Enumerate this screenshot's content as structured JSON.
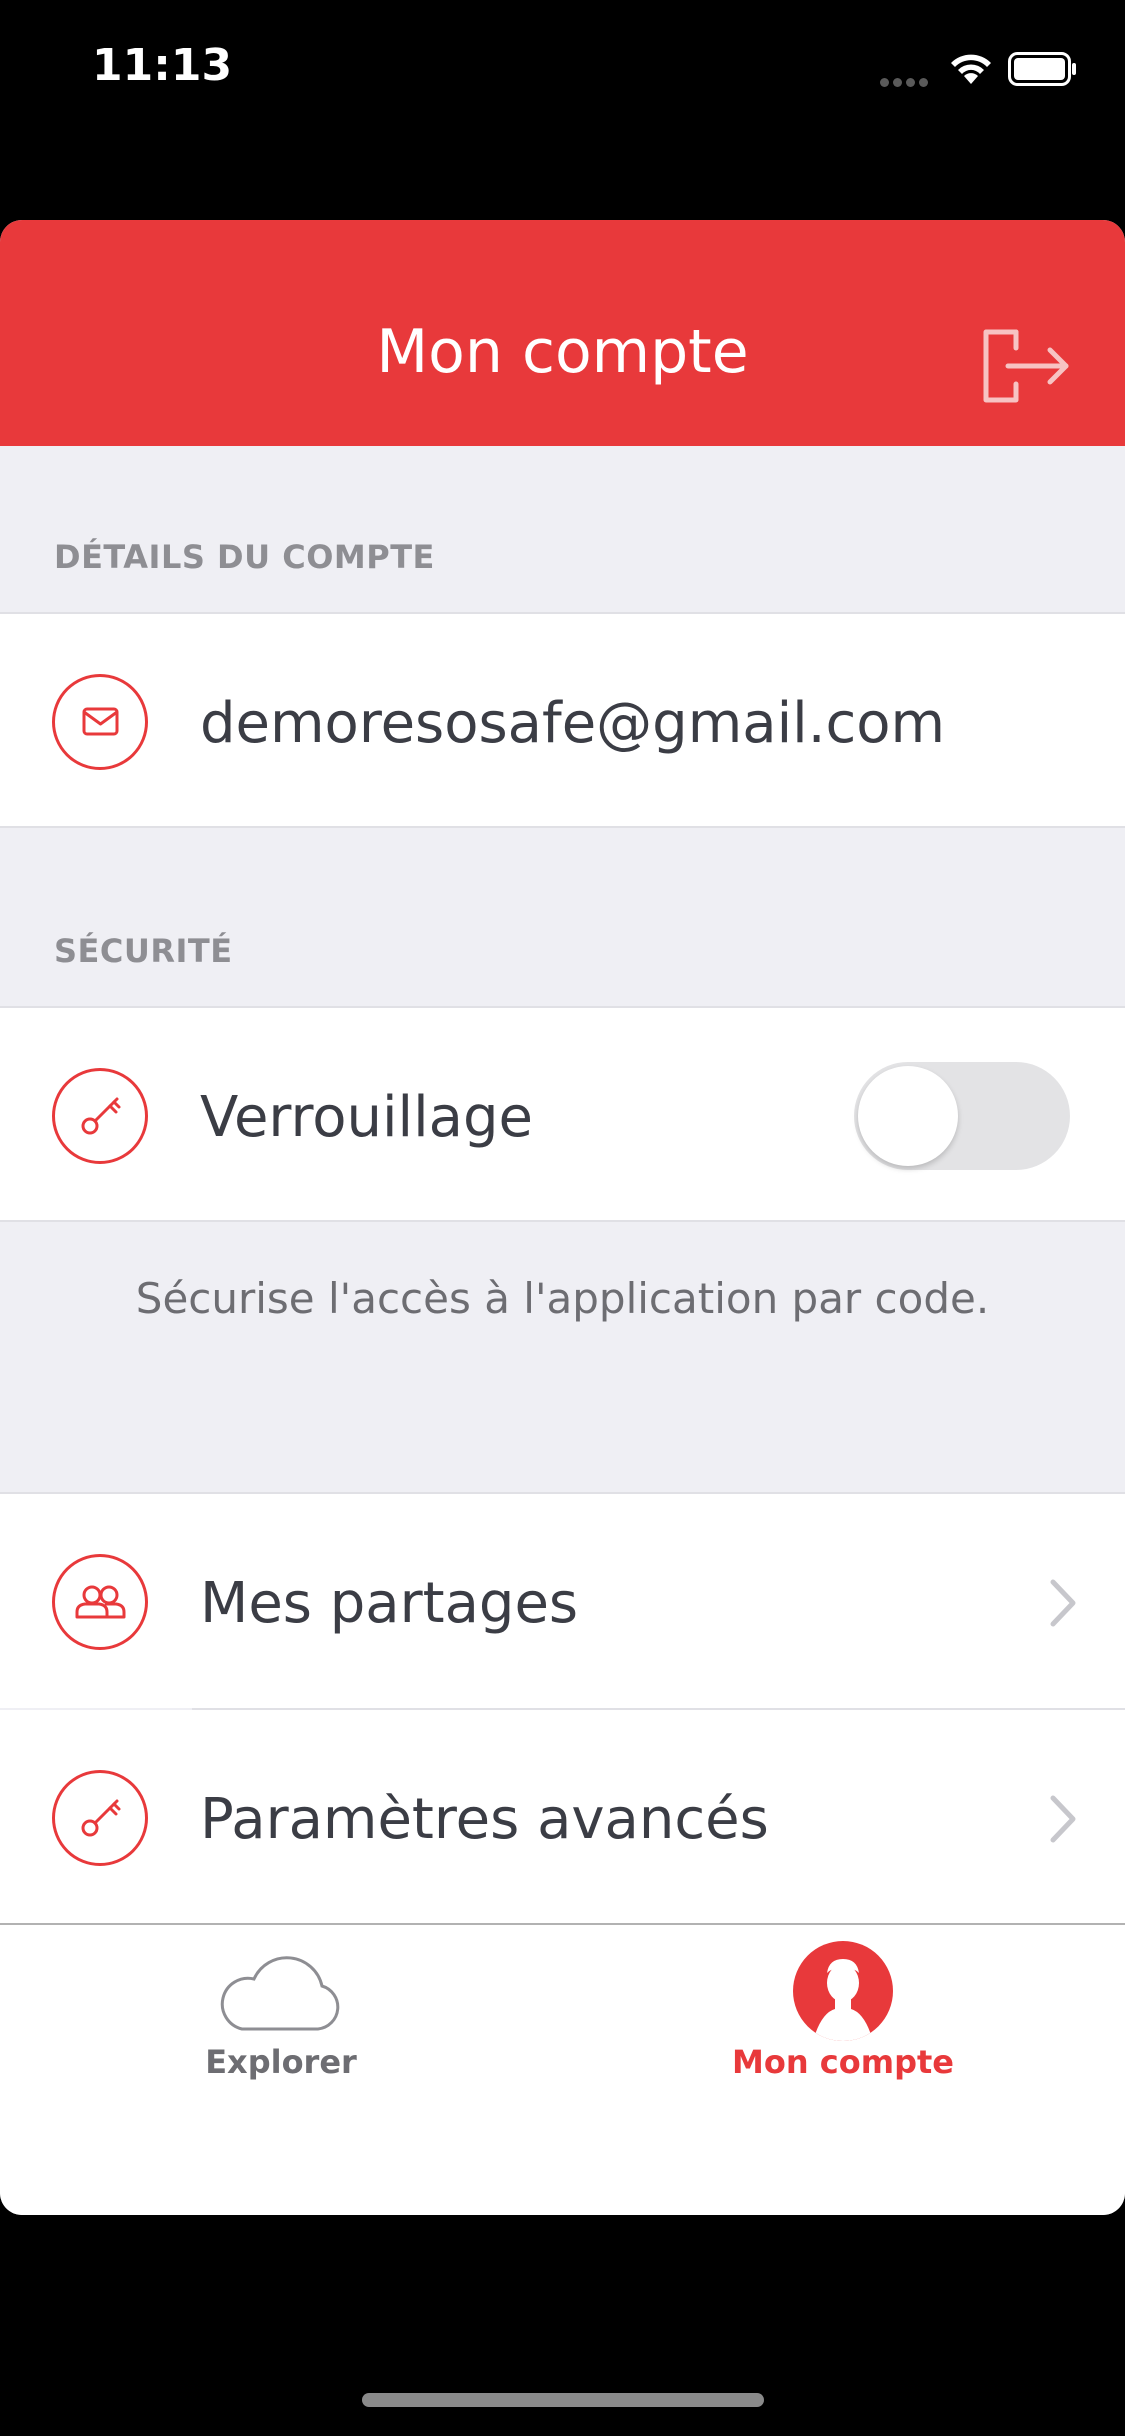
{
  "status_bar": {
    "time": "11:13"
  },
  "nav": {
    "title": "Mon compte",
    "logout_icon": "logout-icon"
  },
  "sections": {
    "account_header": "DÉTAILS DU COMPTE",
    "email": "demoresosafe@gmail.com",
    "security_header": "SÉCURITÉ",
    "lock_label": "Verrouillage",
    "lock_enabled": false,
    "lock_footer": "Sécurise l'accès à l'application par code.",
    "shares_label": "Mes partages",
    "advanced_label": "Paramètres avancés"
  },
  "tabs": [
    {
      "label": "Explorer",
      "icon": "cloud-icon",
      "selected": false
    },
    {
      "label": "Mon compte",
      "icon": "user-icon",
      "selected": true
    }
  ],
  "colors": {
    "accent": "#e8393b",
    "background": "#efeff4",
    "text": "#3b3d45",
    "secondary": "#8e8e93"
  }
}
